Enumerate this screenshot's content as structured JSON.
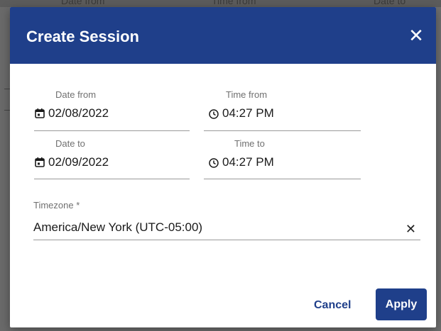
{
  "backdrop": {
    "labels": [
      "Date from",
      "Time from",
      "Date to"
    ]
  },
  "dialog": {
    "title": "Create Session",
    "close_icon": "close-icon"
  },
  "date_from": {
    "label": "Date from",
    "value": "02/08/2022",
    "icon": "calendar-icon"
  },
  "time_from": {
    "label": "Time from",
    "value": "04:27 PM",
    "icon": "clock-icon"
  },
  "date_to": {
    "label": "Date to",
    "value": "02/09/2022",
    "icon": "calendar-icon"
  },
  "time_to": {
    "label": "Time to",
    "value": "04:27 PM",
    "icon": "clock-icon"
  },
  "timezone": {
    "label": "Timezone *",
    "value": "America/New York (UTC-05:00)",
    "clear_icon": "close-icon"
  },
  "actions": {
    "cancel_label": "Cancel",
    "apply_label": "Apply"
  },
  "colors": {
    "primary": "#1f3f8a",
    "header_text": "#ffffff",
    "label": "#707070"
  }
}
